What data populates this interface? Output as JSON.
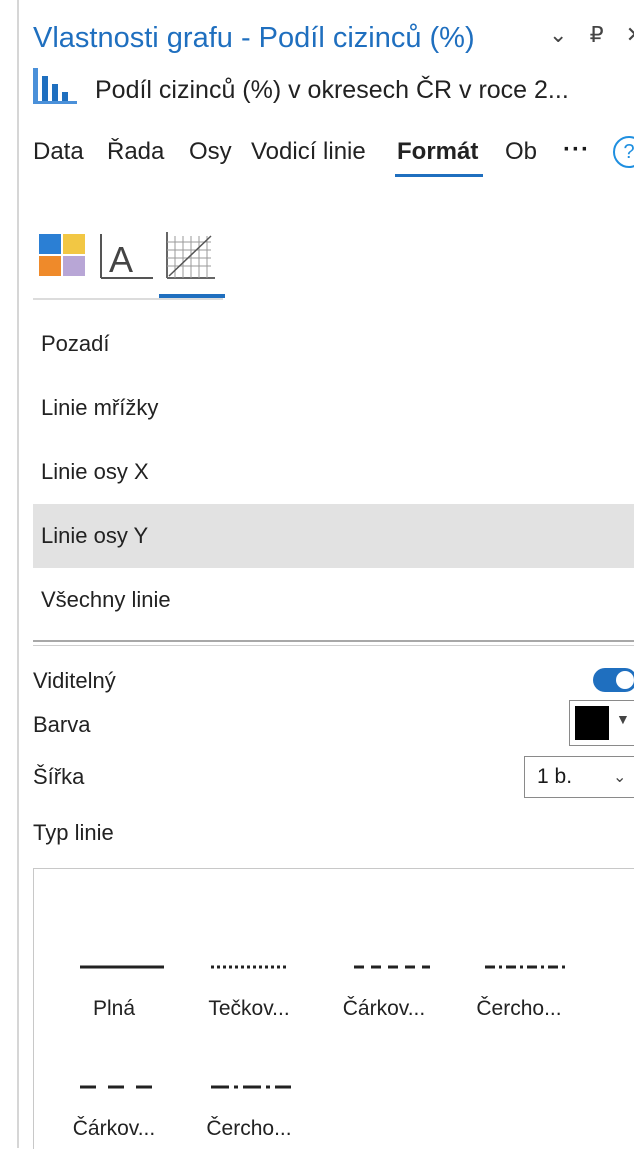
{
  "window": {
    "title": "Vlastnosti grafu - Podíl cizinců (%)",
    "controls": [
      "⌄",
      "₽",
      "✕"
    ]
  },
  "chart": {
    "name": "Podíl cizinců (%) v okresech ČR v roce 2..."
  },
  "tabs": [
    "Data",
    "Řada",
    "Osy",
    "Vodicí linie",
    "Formát",
    "Ob"
  ],
  "active_tab": "Formát",
  "tab_overflow": "···",
  "help_glyph": "?",
  "format_subtabs": [
    {
      "icon": "color-theme-icon"
    },
    {
      "icon": "text-format-icon"
    },
    {
      "icon": "grid-lines-icon"
    }
  ],
  "elements": [
    "Pozadí",
    "Linie mřížky",
    "Linie osy X",
    "Linie osy Y",
    "Všechny linie"
  ],
  "selected_element": "Linie osy Y",
  "properties": {
    "visible_label": "Viditelný",
    "visible_on": true,
    "color_label": "Barva",
    "color_value": "#000000",
    "width_label": "Šířka",
    "width_value": "1 b.",
    "line_type_label": "Typ linie"
  },
  "line_types": [
    {
      "label": "Plná",
      "pattern": "solid"
    },
    {
      "label": "Tečkov...",
      "pattern": "dotted"
    },
    {
      "label": "Čárkov...",
      "pattern": "dashed"
    },
    {
      "label": "Čercho...",
      "pattern": "dashdot"
    },
    {
      "label": "Čárkov...",
      "pattern": "longdash"
    },
    {
      "label": "Čercho...",
      "pattern": "longdashdot"
    }
  ],
  "colors": {
    "accent": "#1f6fbf",
    "selected_row": "#e2e2e2"
  }
}
